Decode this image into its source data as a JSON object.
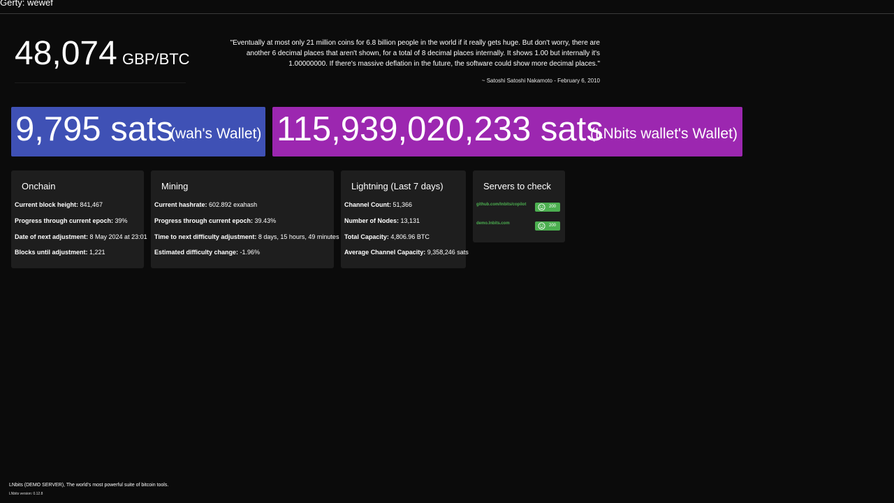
{
  "header": {
    "title": "Gerty: wewef"
  },
  "price": {
    "value": "48,074",
    "unit": "GBP/BTC"
  },
  "quote": {
    "text": "\"Eventually at most only 21 million coins for 6.8 billion people in the world if it really gets huge. But don't worry, there are another 6 decimal places that aren't shown, for a total of 8 decimal places internally. It shows 1.00 but internally it's 1.00000000. If there's massive deflation in the future, the software could show more decimal places.\"",
    "author": "~ Satoshi Satoshi Nakamoto - February 6, 2010"
  },
  "wallets": [
    {
      "amount": "9,795 sats",
      "name": "(wah's Wallet)",
      "color": "#3f51b5"
    },
    {
      "amount": "115,939,020,233 sats",
      "name": "(LNbits wallet's Wallet)",
      "color": "#9c27b0"
    }
  ],
  "onchain": {
    "title": "Onchain",
    "rows": [
      {
        "label": "Current block height:",
        "value": "841,467"
      },
      {
        "label": "Progress through current epoch:",
        "value": "39%"
      },
      {
        "label": "Date of next adjustment:",
        "value": "8 May 2024 at 23:01"
      },
      {
        "label": "Blocks until adjustment:",
        "value": "1,221"
      }
    ]
  },
  "mining": {
    "title": "Mining",
    "rows": [
      {
        "label": "Current hashrate:",
        "value": "602.892 exahash"
      },
      {
        "label": "Progress through current epoch:",
        "value": "39.43%"
      },
      {
        "label": "Time to next difficulty adjustment:",
        "value": "8 days, 15 hours, 49 minutes"
      },
      {
        "label": "Estimated difficulty change:",
        "value": "-1.96%"
      }
    ]
  },
  "lightning": {
    "title": "Lightning (Last 7 days)",
    "rows": [
      {
        "label": "Channel Count:",
        "value": "51,366"
      },
      {
        "label": "Number of Nodes:",
        "value": "13,131"
      },
      {
        "label": "Total Capacity:",
        "value": "4,806.96 BTC"
      },
      {
        "label": "Average Channel Capacity:",
        "value": "9,358,246 sats"
      }
    ]
  },
  "servers": {
    "title": "Servers to check",
    "items": [
      {
        "url": "github.com/lnbits/copilot",
        "status": "200",
        "icon": "smile-icon"
      },
      {
        "url": "demo.lnbits.com",
        "status": "200",
        "icon": "smile-icon"
      }
    ]
  },
  "footer": {
    "tagline": "LNbits (DEMO SERVER), The world's most powerful suite of bitcoin tools.",
    "version": "LNbits version: 0.12.8"
  },
  "colors": {
    "background": "#0b0b0b",
    "card": "#1e1e1e",
    "success": "#4caf50"
  }
}
